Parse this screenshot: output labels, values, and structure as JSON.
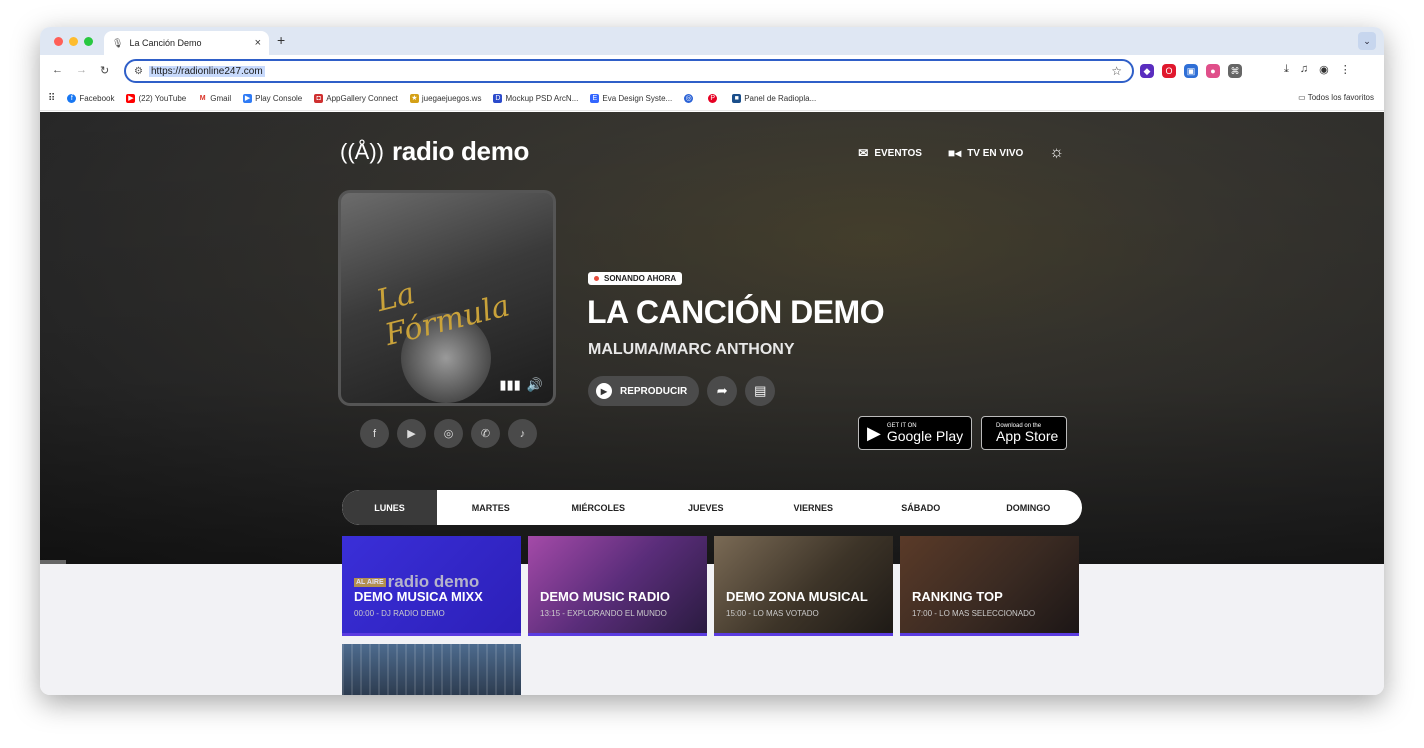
{
  "browser": {
    "tab_title": "La Canción Demo",
    "tab_close": "×",
    "new_tab": "+",
    "url": "https://radionline247.com",
    "bookmarks": [
      {
        "label": "Facebook",
        "icon": "facebook-icon",
        "color": "#1877f2"
      },
      {
        "label": "(22) YouTube",
        "icon": "youtube-icon",
        "color": "#ff0000"
      },
      {
        "label": "Gmail",
        "icon": "gmail-icon",
        "color": "#d93025"
      },
      {
        "label": "Play Console",
        "icon": "play-console-icon",
        "color": "#2f7bf5"
      },
      {
        "label": "AppGallery Connect",
        "icon": "appgallery-icon",
        "color": "#cf2f2f"
      },
      {
        "label": "juegaejuegos.ws",
        "icon": "juegos-icon",
        "color": "#d4a017"
      },
      {
        "label": "Mockup PSD ArcN...",
        "icon": "mockup-icon",
        "color": "#2b4acb"
      },
      {
        "label": "Eva Design Syste...",
        "icon": "eva-icon",
        "color": "#3366ff"
      },
      {
        "label": "",
        "icon": "bookmark-icon-a",
        "color": "#2a62d6"
      },
      {
        "label": "",
        "icon": "pinterest-icon",
        "color": "#e60023"
      },
      {
        "label": "Panel de Radiopla...",
        "icon": "panel-icon",
        "color": "#1a4e8a"
      }
    ],
    "all_bookmarks": "Todos los favoritos"
  },
  "site": {
    "brand": "radio demo",
    "nav": {
      "events": "EVENTOS",
      "tv_live": "TV EN VIVO"
    },
    "now_playing_badge": "SONANDO AHORA",
    "song_title": "LA CANCIÓN DEMO",
    "artist": "MALUMA/MARC ANTHONY",
    "play_label": "REPRODUCIR",
    "cover_script": "La Fórmula",
    "google_play": {
      "small": "GET IT ON",
      "big": "Google Play"
    },
    "app_store": {
      "small": "Download on the",
      "big": "App Store"
    },
    "days": [
      "LUNES",
      "MARTES",
      "MIÉRCOLES",
      "JUEVES",
      "VIERNES",
      "SÁBADO",
      "DOMINGO"
    ],
    "active_day": "LUNES",
    "programs": [
      {
        "title": "DEMO MUSICA MIXX",
        "subtitle": "00:00 - DJ RADIO DEMO",
        "brand_tag": "AL AIRE",
        "brand": "radio demo"
      },
      {
        "title": "DEMO MUSIC RADIO",
        "subtitle": "13:15 - EXPLORANDO EL MUNDO",
        "brand_tag": "",
        "brand": ""
      },
      {
        "title": "DEMO ZONA MUSICAL",
        "subtitle": "15:00 - LO MAS VOTADO",
        "brand_tag": "",
        "brand": ""
      },
      {
        "title": "RANKING TOP",
        "subtitle": "17:00 - LO MAS SELECCIONADO",
        "brand_tag": "",
        "brand": ""
      }
    ]
  },
  "colors": {
    "accent_purple": "#5b3ce0",
    "live_red": "#e74c3c",
    "gold": "#c9a23a"
  }
}
